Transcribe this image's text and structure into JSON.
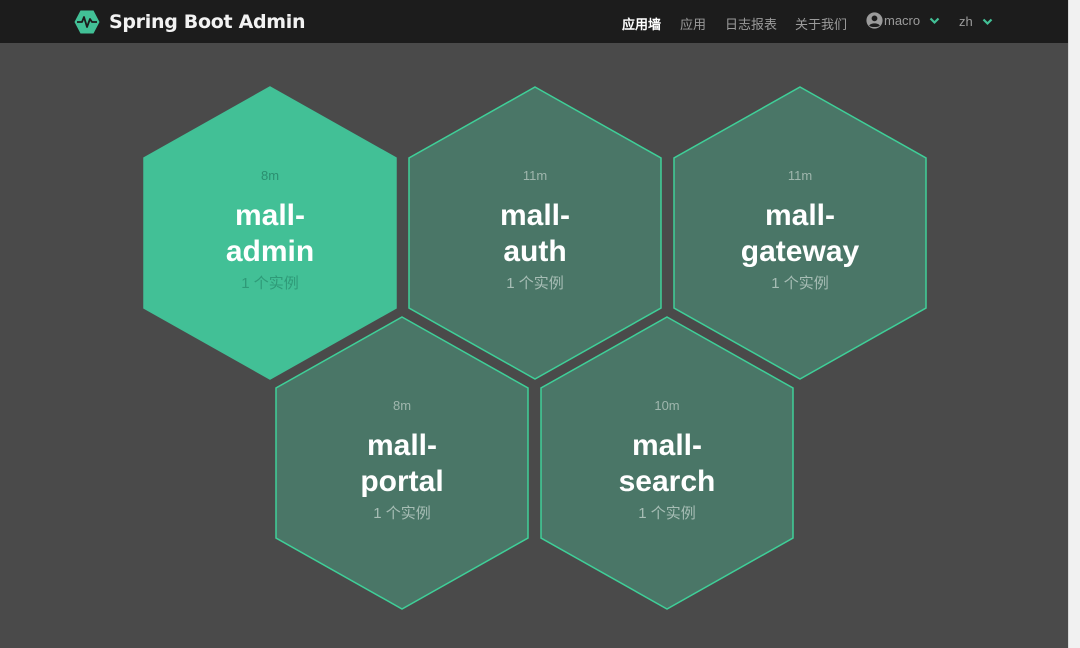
{
  "header": {
    "brand": "Spring Boot Admin",
    "nav": [
      {
        "label": "应用墙",
        "active": true
      },
      {
        "label": "应用",
        "active": false
      },
      {
        "label": "日志报表",
        "active": false
      },
      {
        "label": "关于我们",
        "active": false
      }
    ],
    "user": "macro",
    "language": "zh"
  },
  "colors": {
    "accent": "#42c096",
    "hex_fill": "#4a7667",
    "hex_stroke": "#3fcf98",
    "navbar": "#1c1c1c",
    "background": "#4a4a4a"
  },
  "applications": [
    {
      "uptime": "8m",
      "name_line1": "mall-",
      "name_line2": "admin",
      "instances": "1 个实例",
      "highlighted": true
    },
    {
      "uptime": "11m",
      "name_line1": "mall-",
      "name_line2": "auth",
      "instances": "1 个实例",
      "highlighted": false
    },
    {
      "uptime": "11m",
      "name_line1": "mall-",
      "name_line2": "gateway",
      "instances": "1 个实例",
      "highlighted": false
    },
    {
      "uptime": "8m",
      "name_line1": "mall-",
      "name_line2": "portal",
      "instances": "1 个实例",
      "highlighted": false
    },
    {
      "uptime": "10m",
      "name_line1": "mall-",
      "name_line2": "search",
      "instances": "1 个实例",
      "highlighted": false
    }
  ]
}
